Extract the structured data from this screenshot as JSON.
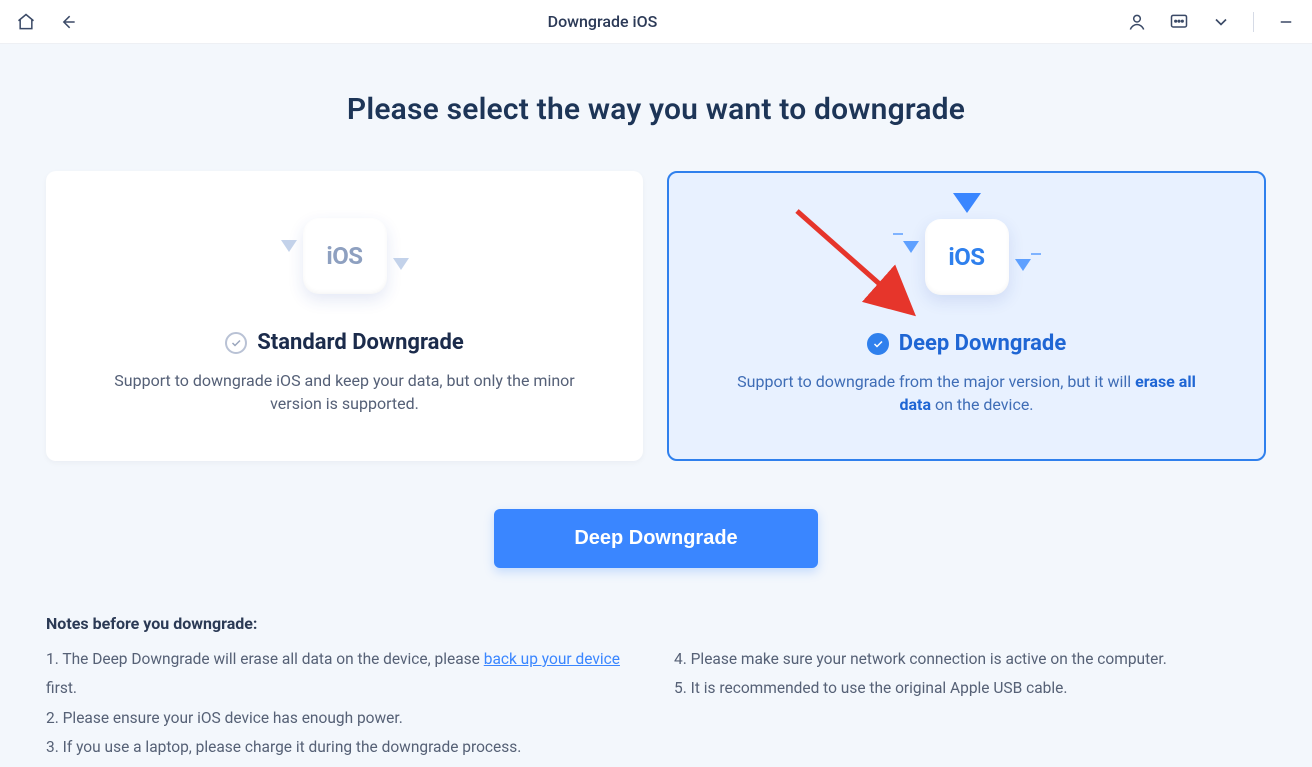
{
  "header": {
    "title": "Downgrade iOS"
  },
  "page_heading": "Please select the way you want to downgrade",
  "cards": {
    "standard": {
      "title": "Standard Downgrade",
      "ios_label": "iOS",
      "desc": "Support to downgrade iOS and keep your data, but only the minor version is supported.",
      "selected": false
    },
    "deep": {
      "title": "Deep Downgrade",
      "ios_label": "iOS",
      "desc_prefix": "Support to downgrade from the major version, but it will ",
      "desc_bold": "erase all data",
      "desc_suffix": " on the device.",
      "selected": true
    }
  },
  "cta_label": "Deep Downgrade",
  "notes": {
    "title": "Notes before you downgrade:",
    "left": {
      "n1_prefix": "1.  The Deep Downgrade will erase all data on the device, please ",
      "n1_link": "back up your device",
      "n1_suffix": " first.",
      "n2": "2.  Please ensure your iOS device has enough power.",
      "n3": "3.  If you use a laptop, please charge it during the downgrade process."
    },
    "right": {
      "n4": "4.  Please make sure your network connection is active on the computer.",
      "n5": "5.  It is recommended to use the original Apple USB cable."
    }
  }
}
